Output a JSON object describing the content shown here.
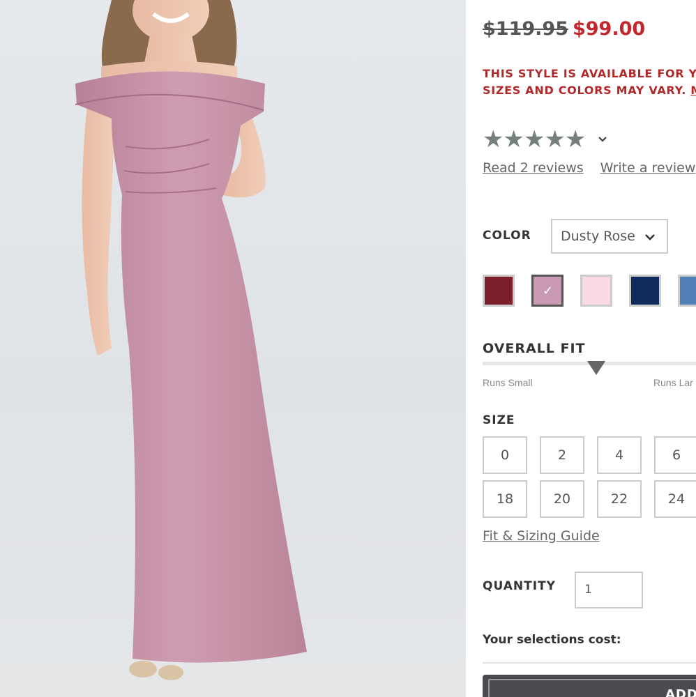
{
  "product": {
    "old_price": "$119.95",
    "new_price": "$99.00",
    "notice_line1": "THIS STYLE IS AVAILABLE FOR YO",
    "notice_line2": "SIZES AND COLORS MAY VARY. ",
    "notice_link": "M"
  },
  "reviews": {
    "stars": "★★★★★",
    "rating": 5,
    "read_label": "Read 2 reviews",
    "write_label": "Write a review"
  },
  "color": {
    "label": "COLOR",
    "selected": "Dusty Rose",
    "swatches": [
      {
        "hex": "#7a1f2b",
        "selected": false
      },
      {
        "hex": "#c99ab1",
        "selected": true,
        "mark": "✓"
      },
      {
        "hex": "#fbd9e2",
        "selected": false
      },
      {
        "hex": "#0f2a5c",
        "selected": false
      },
      {
        "hex": "#4f7fb5",
        "selected": false
      }
    ]
  },
  "fit": {
    "label": "OVERALL FIT",
    "low": "Runs Small",
    "high": "Runs Lar"
  },
  "size": {
    "label": "SIZE",
    "row1": [
      "0",
      "2",
      "4",
      "6"
    ],
    "row2": [
      "18",
      "20",
      "22",
      "24"
    ],
    "guide_label": "Fit & Sizing Guide"
  },
  "quantity": {
    "label": "QUANTITY",
    "value": "1"
  },
  "cart": {
    "cost_label": "Your selections cost:",
    "add_label": "ADD"
  }
}
